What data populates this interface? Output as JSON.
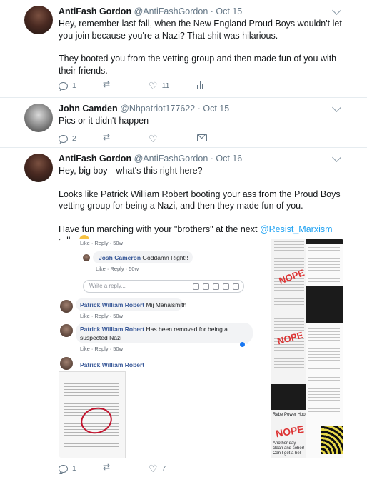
{
  "tweets": [
    {
      "name": "AntiFash Gordon",
      "handle": "@AntiFashGordon",
      "time": "· Oct 15",
      "paragraphs": [
        "Hey, remember last fall, when the New England Proud Boys wouldn't let you join because you're a Nazi? That shit was hilarious.",
        "They booted you from the vetting group and then made fun of you with their friends."
      ],
      "replies": "1",
      "retweets": "",
      "likes": "11"
    },
    {
      "name": "John Camden",
      "handle": "@Nhpatriot177622",
      "time": "· Oct 15",
      "paragraphs": [
        "Pics or it didn't happen"
      ],
      "replies": "2",
      "retweets": "",
      "likes": ""
    },
    {
      "name": "AntiFash Gordon",
      "handle": "@AntiFashGordon",
      "time": "· Oct 16",
      "p1": "Hey, big boy-- what's this right here?",
      "p2": "Looks like Patrick William Robert booting your ass from the Proud Boys vetting group for being a Nazi, and then they made fun of you.",
      "p3_before": "Have fun marching with your \"brothers\" at the next ",
      "p3_link": "@Resist_Marxism",
      "p3_after": " rally.",
      "replies": "1",
      "retweets": "",
      "likes": "7"
    }
  ],
  "attachment": {
    "like_reply_1": "Like · Reply · 50w",
    "comment_2_name": "Josh Cameron",
    "comment_2_text": "Goddamn Right!!",
    "like_reply_2": "Like · Reply · 50w",
    "write_reply_placeholder": "Write a reply...",
    "comment_3_name": "Patrick William Robert",
    "comment_3_text": "Mij Manalsmith",
    "like_reply_3": "Like · Reply · 50w",
    "comment_4_name": "Patrick William Robert",
    "comment_4_text_line1": "Has been removed for being a",
    "comment_4_text_line2": "suspected Nazi",
    "like_reply_4": "Like · Reply · 50w",
    "reaction_count": "1",
    "comment_5_name": "Patrick William Robert",
    "thumb_text_nope": "NOPE",
    "thumb_text_1": "Rebe Power Hooligan",
    "thumb_text_2": "Another day clean and sober! Can I get a hell"
  },
  "colors": {
    "link": "#1da1f2",
    "fb_link": "#385898",
    "muted": "#657786",
    "scribble": "#c2142e"
  },
  "icons": [
    "reply-icon",
    "retweet-icon",
    "heart-icon",
    "stats-icon",
    "mail-icon",
    "chevron-down-icon",
    "kiss-emoji-icon"
  ]
}
